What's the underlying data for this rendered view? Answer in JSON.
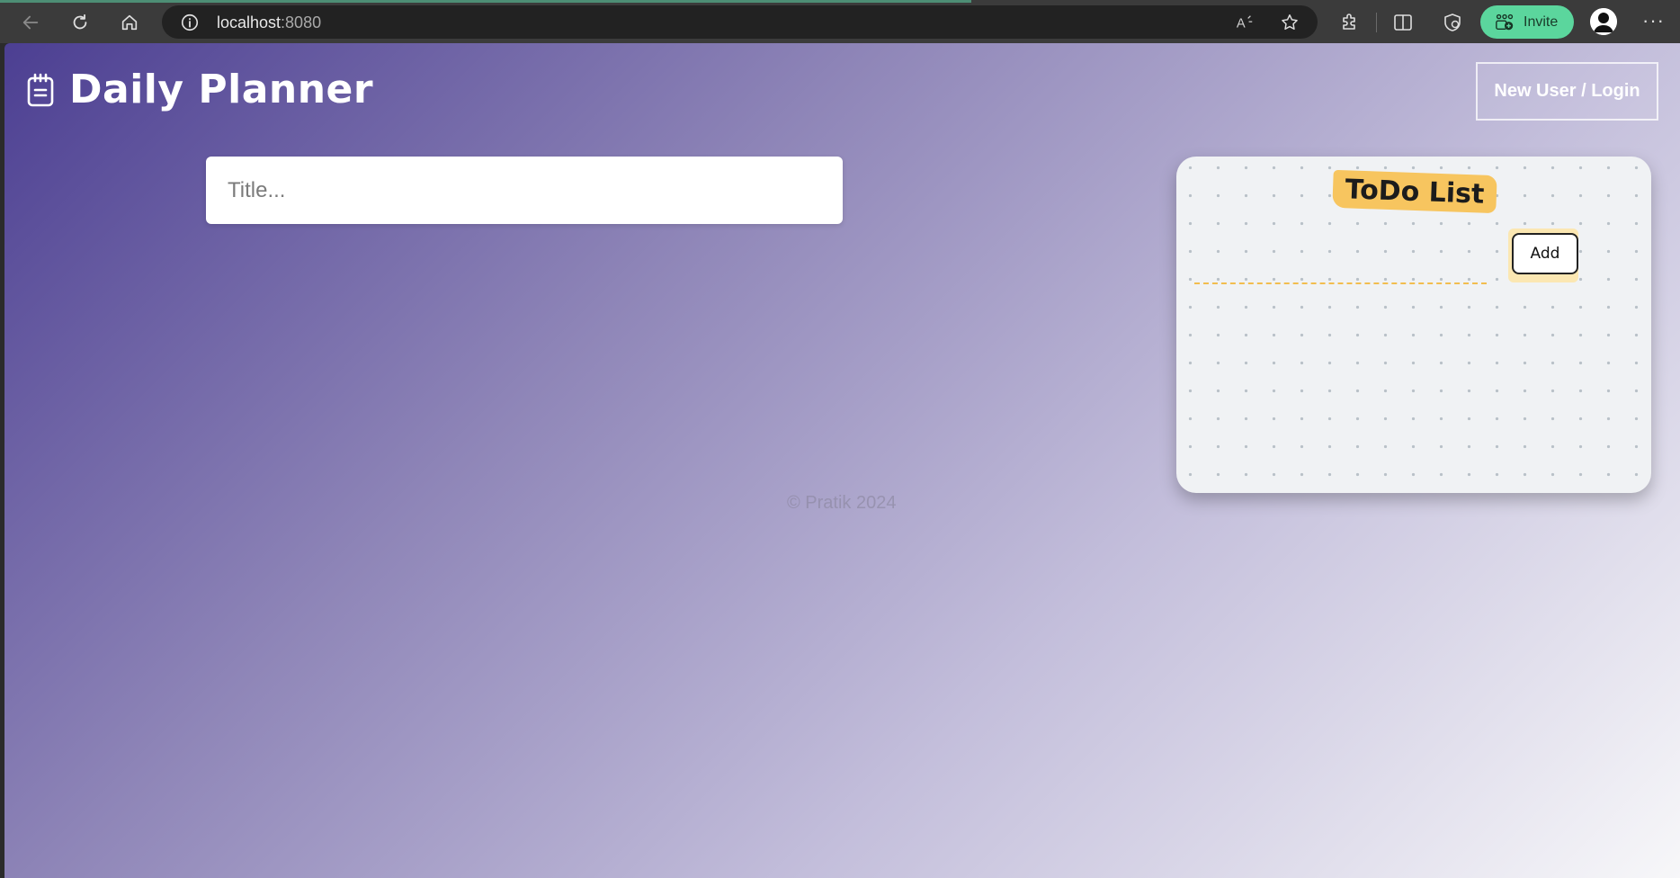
{
  "browser": {
    "url_host": "localhost",
    "url_port": ":8080",
    "invite_label": "Invite",
    "more_label": "···",
    "icons": [
      "back-icon",
      "refresh-icon",
      "home-icon",
      "info-icon",
      "read-aloud-icon",
      "favorite-star-icon",
      "extensions-icon",
      "split-screen-icon",
      "browser-essentials-icon",
      "invite-people-icon",
      "profile-avatar-icon",
      "more-icon"
    ]
  },
  "app": {
    "title": "Daily Planner",
    "title_icon": "notepad-icon",
    "login_label": "New User / Login",
    "title_placeholder": "Title...",
    "footer": "© Pratik 2024"
  },
  "todo": {
    "heading": "ToDo List",
    "add_label": "Add"
  },
  "colors": {
    "gradient_start": "#4c3f92",
    "gradient_end": "#f7f7f9",
    "todo_accent": "#f7c55f",
    "invite_green": "#5bd69d"
  }
}
